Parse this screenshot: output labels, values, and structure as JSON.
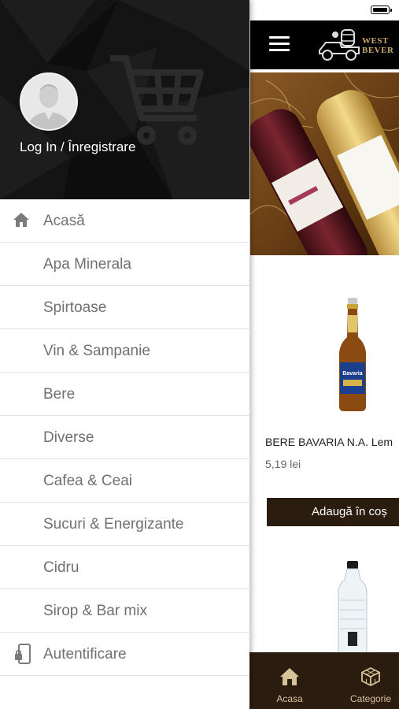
{
  "drawer": {
    "login_label": "Log In / Înregistrare",
    "menu": [
      {
        "label": "Acasă",
        "icon": "home-icon"
      },
      {
        "label": "Apa Minerala"
      },
      {
        "label": "Spirtoase"
      },
      {
        "label": "Vin & Sampanie"
      },
      {
        "label": "Bere"
      },
      {
        "label": "Diverse"
      },
      {
        "label": "Cafea & Ceai"
      },
      {
        "label": "Sucuri & Energizante"
      },
      {
        "label": "Cidru"
      },
      {
        "label": "Sirop & Bar mix"
      },
      {
        "label": "Autentificare",
        "icon": "phone-lock-icon"
      }
    ]
  },
  "header": {
    "logo_text_line1": "WEST",
    "logo_text_line2": "BEVER"
  },
  "product": {
    "name": "BERE BAVARIA N.A. Lem",
    "price": "5,19 lei",
    "add_button": "Adaugă în coș",
    "bottle_label": "Bavaria"
  },
  "tabbar": {
    "tabs": [
      {
        "label": "Acasa",
        "icon": "home-icon"
      },
      {
        "label": "Categorie",
        "icon": "cube-icon"
      }
    ]
  },
  "colors": {
    "drawer_header_bg": "#121212",
    "accent_brown": "#2b1c10",
    "tab_text": "#d8c29a",
    "menu_text": "#707070"
  }
}
